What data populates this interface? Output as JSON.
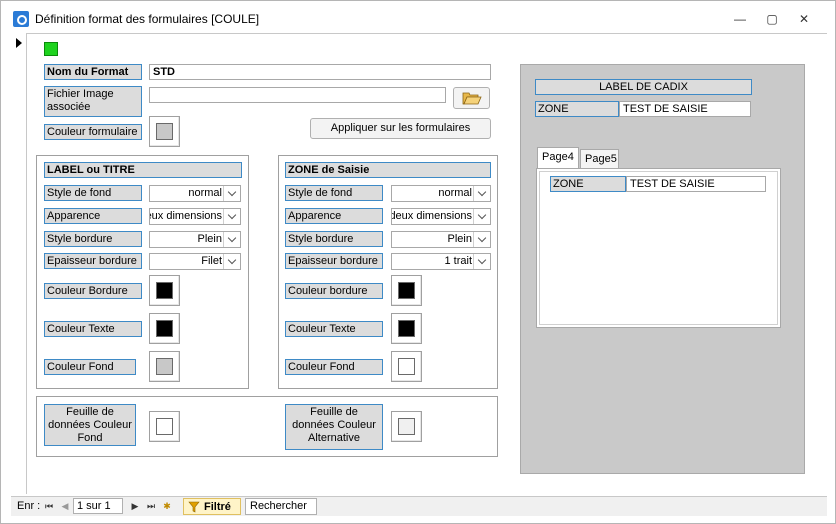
{
  "window": {
    "title": "Définition format des formulaires [COULE]",
    "minimize": "—",
    "restore": "▢",
    "close": "✕"
  },
  "colors": {
    "accent_green": "#1ed31e",
    "label_bg": "#dcdcdc",
    "label_border": "#3e8ac6",
    "preview_bg": "#c9c9c9",
    "swatch_black": "#000000",
    "swatch_gray": "#c8c8c8",
    "swatch_white": "#ffffff"
  },
  "header": {
    "format_name_label": "Nom du Format",
    "format_name_value": "STD",
    "image_file_label": "Fichier Image associée",
    "image_file_value": "",
    "form_color_label": "Couleur formulaire",
    "apply_button": "Appliquer sur les formulaires",
    "browse_icon": "folder-open-icon"
  },
  "label_group": {
    "title": "LABEL ou TITRE",
    "bg_style_label": "Style de fond",
    "bg_style_value": "normal",
    "appearance_label": "Apparence",
    "appearance_value": "eux dimensions",
    "border_style_label": "Style bordure",
    "border_style_value": "Plein",
    "border_width_label": "Epaisseur bordure",
    "border_width_value": "Filet",
    "border_color_label": "Couleur Bordure",
    "text_color_label": "Couleur Texte",
    "bg_color_label": "Couleur Fond"
  },
  "zone_group": {
    "title": "ZONE de Saisie",
    "bg_style_label": "Style de fond",
    "bg_style_value": "normal",
    "appearance_label": "Apparence",
    "appearance_value": "deux dimensions",
    "border_style_label": "Style bordure",
    "border_style_value": "Plein",
    "border_width_label": "Epaisseur bordure",
    "border_width_value": "1 trait",
    "border_color_label": "Couleur bordure",
    "text_color_label": "Couleur Texte",
    "bg_color_label": "Couleur Fond"
  },
  "datasheet": {
    "bg_label": "Feuille de données Couleur Fond",
    "alt_label": "Feuille de données Couleur Alternative"
  },
  "preview": {
    "label_caption": "LABEL DE CADIX",
    "zone_label": "ZONE",
    "zone_value": "TEST DE SAISIE",
    "tab1": "Page4",
    "tab2": "Page5",
    "tab_zone_label": "ZONE",
    "tab_zone_value": "TEST DE SAISIE"
  },
  "navbar": {
    "record_label": "Enr :",
    "first_icon": "first-record-icon",
    "prev_icon": "prev-record-icon",
    "position": "1 sur 1",
    "next_icon": "next-record-icon",
    "last_icon": "last-record-icon",
    "new_icon": "new-record-icon",
    "filter_label": "Filtré",
    "search_label": "Rechercher"
  }
}
